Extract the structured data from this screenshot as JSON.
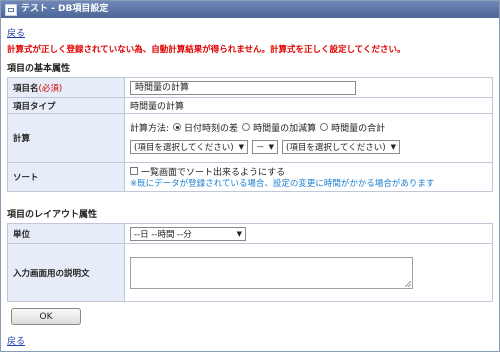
{
  "window": {
    "title": "テスト - DB項目設定"
  },
  "links": {
    "back_top": "戻る",
    "back_bottom": "戻る"
  },
  "error_message": "計算式が正しく登録されていない為、自動計算結果が得られません。計算式を正しく設定してください。",
  "basic_section": {
    "title": "項目の基本属性",
    "rows": {
      "name": {
        "label": "項目名",
        "required": "(必須)",
        "value": "時間量の計算"
      },
      "type": {
        "label": "項目タイプ",
        "value": "時間量の計算"
      },
      "calc": {
        "label": "計算",
        "method_label": "計算方法:",
        "options": [
          "日付時刻の差",
          "時間量の加減算",
          "時間量の合計"
        ],
        "selected_option": "日付時刻の差",
        "select1": "(項目を選択してください)",
        "operator": "－",
        "select2": "(項目を選択してください)"
      },
      "sort": {
        "label": "ソート",
        "checkbox_label": "一覧画面でソート出来るようにする",
        "note": "※既にデータが登録されている場合、設定の変更に時間がかかる場合があります"
      }
    }
  },
  "layout_section": {
    "title": "項目のレイアウト属性",
    "rows": {
      "unit": {
        "label": "単位",
        "value": "--日 --時間 --分"
      },
      "description": {
        "label": "入力画面用の説明文",
        "value": ""
      }
    }
  },
  "buttons": {
    "ok": "OK"
  }
}
